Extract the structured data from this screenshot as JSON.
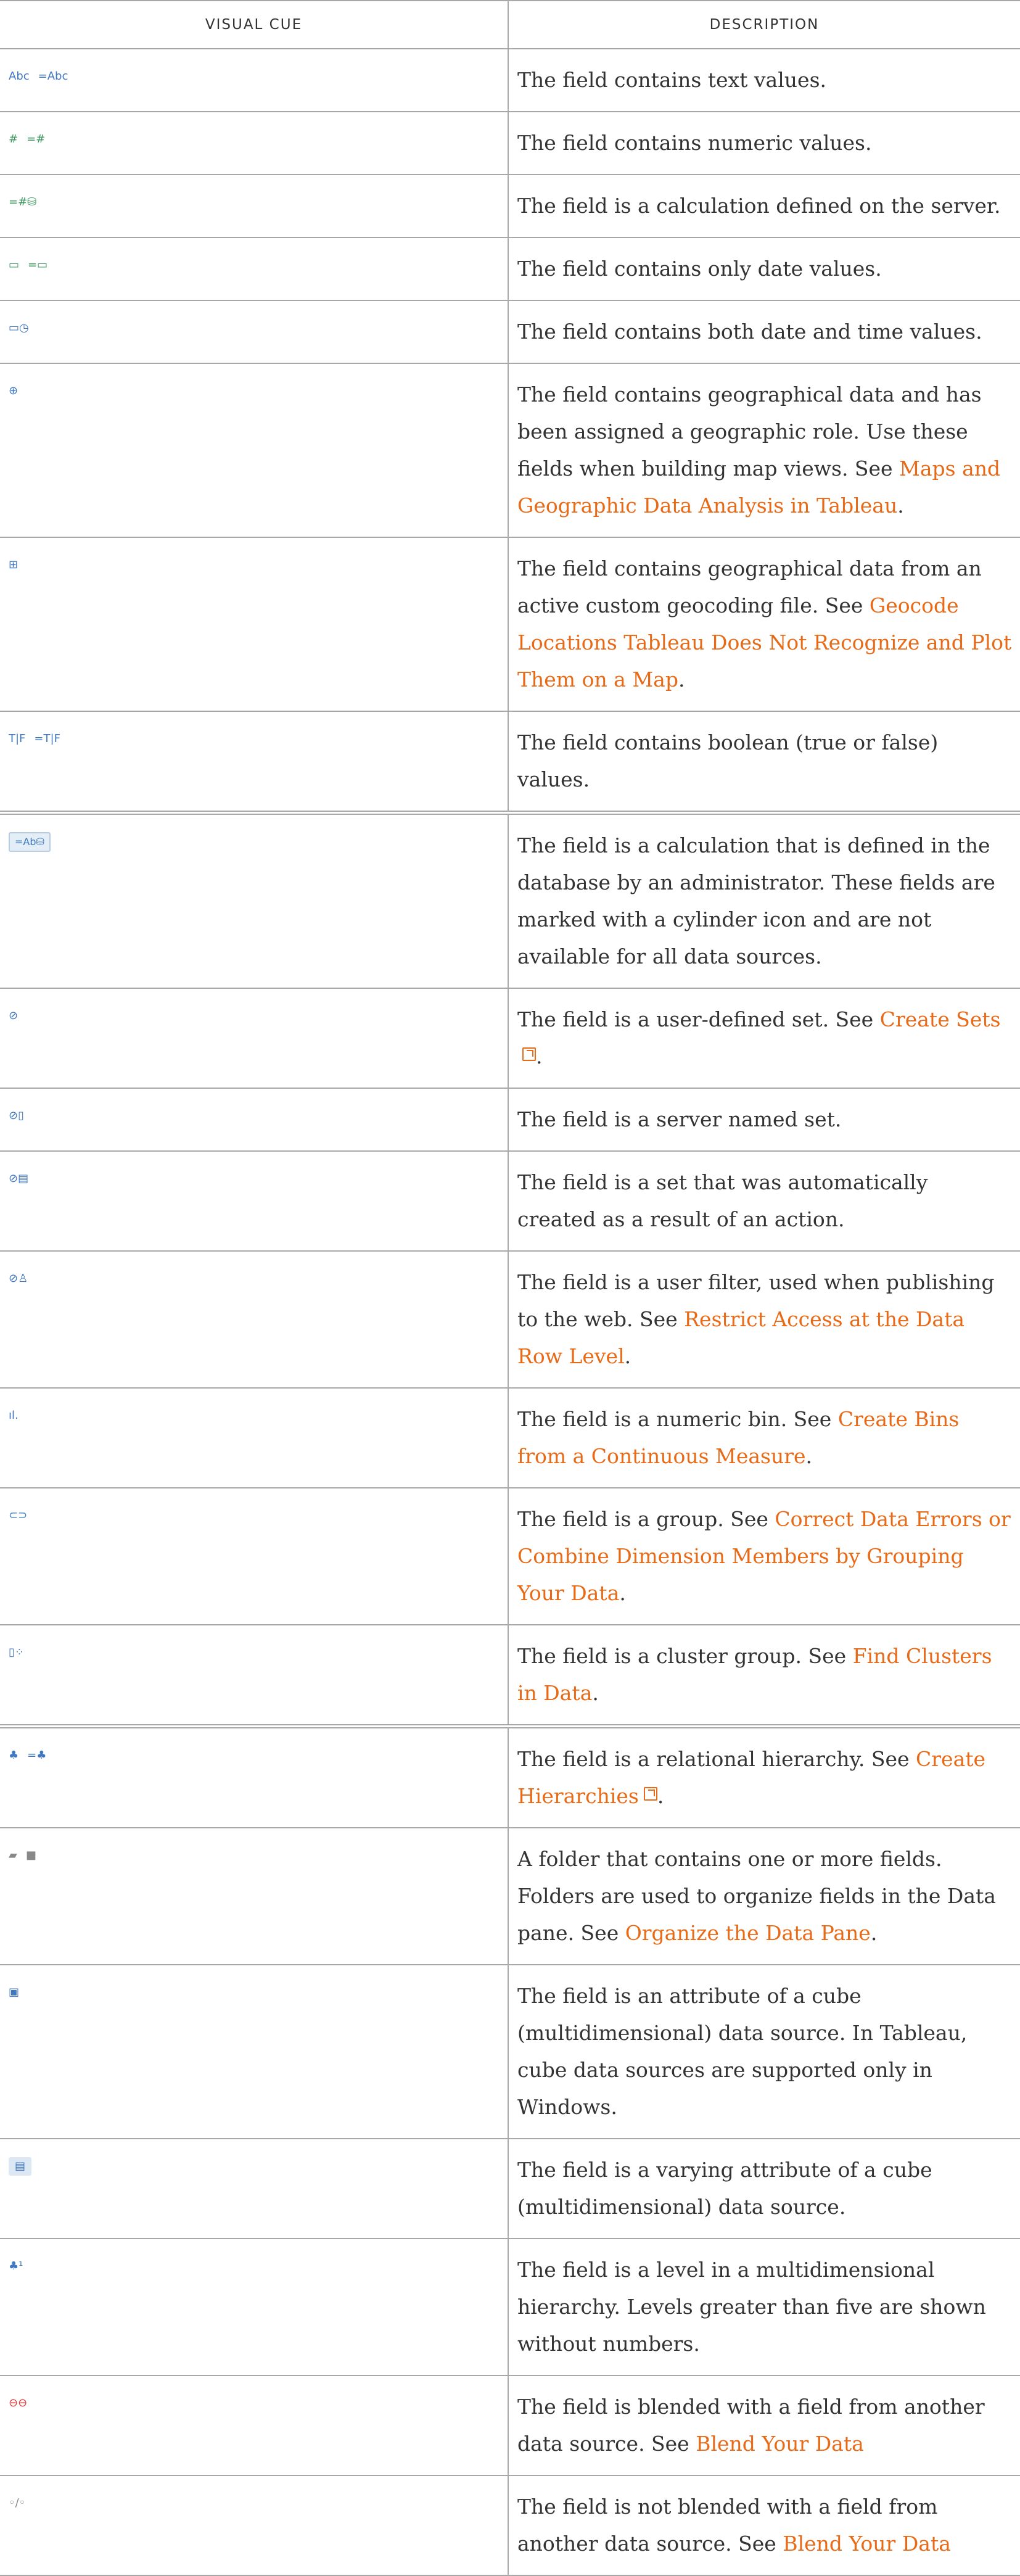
{
  "header": {
    "col1": "VISUAL CUE",
    "col2": "DESCRIPTION"
  },
  "rows": [
    {
      "icons": [
        {
          "glyph": "Abc",
          "icon": "text-icon"
        },
        {
          "glyph": "=Abc",
          "icon": "text-calc-icon"
        }
      ],
      "text": [
        "The field contains text values."
      ]
    },
    {
      "icons": [
        {
          "glyph": "#",
          "icon": "number-icon"
        },
        {
          "glyph": "=#",
          "icon": "number-calc-icon"
        }
      ],
      "text": [
        "The field contains numeric values."
      ]
    },
    {
      "icons": [
        {
          "glyph": "=#⛁",
          "icon": "server-calc-icon"
        }
      ],
      "text": [
        "The field is a calculation defined on the server."
      ]
    },
    {
      "icons": [
        {
          "glyph": "▭",
          "icon": "date-icon"
        },
        {
          "glyph": "=▭",
          "icon": "date-calc-icon"
        }
      ],
      "text": [
        "The field contains only date values."
      ]
    },
    {
      "icons": [
        {
          "glyph": "▭◷",
          "icon": "datetime-icon"
        }
      ],
      "text": [
        "The field contains both date and time values."
      ]
    },
    {
      "icons": [
        {
          "glyph": "⊕",
          "icon": "globe-icon"
        }
      ],
      "text": [
        "The field contains geographical data and has been assigned a geographic role. Use these fields when building map views. See "
      ],
      "link": "Maps and Geographic Data Analysis in Tableau",
      "after": "."
    },
    {
      "icons": [
        {
          "glyph": "⊞",
          "icon": "custom-geocode-icon"
        }
      ],
      "text": [
        "The field contains geographical data from an active custom geocoding file. See "
      ],
      "link": "Geocode Locations Tableau Does Not Recognize and Plot Them on a Map",
      "after": "."
    },
    {
      "icons": [
        {
          "glyph": "T|F",
          "icon": "boolean-icon"
        },
        {
          "glyph": "=T|F",
          "icon": "boolean-calc-icon"
        }
      ],
      "text": [
        "The field contains boolean (true or false) values."
      ]
    },
    {
      "icons": [
        {
          "glyph": "=Ab⛁",
          "icon": "database-calc-icon"
        }
      ],
      "text": [
        "The field is a calculation that is defined in the database by an administrator. These fields are marked with a cylinder icon and are not available for all data sources."
      ]
    },
    {
      "icons": [
        {
          "glyph": "⊘",
          "icon": "set-icon"
        }
      ],
      "text": [
        "The field is a user-defined set. See "
      ],
      "link": "Create Sets",
      "after": ".",
      "ext": true
    },
    {
      "icons": [
        {
          "glyph": "⊘▯",
          "icon": "server-set-icon"
        }
      ],
      "text": [
        "The field is a server named set."
      ]
    },
    {
      "icons": [
        {
          "glyph": "⊘▤",
          "icon": "action-set-icon"
        }
      ],
      "text": [
        "The field is a set that was automatically created as a result of an action."
      ]
    },
    {
      "icons": [
        {
          "glyph": "⊘♙",
          "icon": "user-filter-icon"
        }
      ],
      "text": [
        "The field is a user filter, used when publishing to the web. See "
      ],
      "link": "Restrict Access at the Data Row Level",
      "after": "."
    },
    {
      "icons": [
        {
          "glyph": "ıl.",
          "icon": "bin-icon"
        }
      ],
      "text": [
        "The field is a numeric bin. See "
      ],
      "link": "Create Bins from a Continuous Measure",
      "after": "."
    },
    {
      "icons": [
        {
          "glyph": "⊂⊃",
          "icon": "group-icon"
        }
      ],
      "text": [
        "The field is a group. See "
      ],
      "link": "Correct Data Errors or Combine Dimension Members by Grouping Your Data",
      "after": "."
    },
    {
      "icons": [
        {
          "glyph": "▯⁘",
          "icon": "cluster-icon"
        }
      ],
      "text": [
        "The field is a cluster group. See "
      ],
      "link": "Find Clusters in Data",
      "after": "."
    },
    {
      "icons": [
        {
          "glyph": "♣",
          "icon": "hierarchy-icon"
        },
        {
          "glyph": "=♣",
          "icon": "hierarchy-calc-icon"
        }
      ],
      "text": [
        "The field is a relational hierarchy. See "
      ],
      "link": "Create Hierarchies",
      "after": ".",
      "ext": true
    },
    {
      "icons": [
        {
          "glyph": "▰",
          "icon": "folder-open-icon"
        },
        {
          "glyph": "■",
          "icon": "folder-icon"
        }
      ],
      "text": [
        "A folder that contains one or more fields. Folders are used to organize fields in the Data pane. See "
      ],
      "link": "Organize the Data Pane",
      "after": "."
    },
    {
      "icons": [
        {
          "glyph": "▣",
          "icon": "cube-attribute-icon"
        }
      ],
      "text": [
        "The field is an attribute of a cube (multidimensional) data source. In Tableau, cube data sources are supported only in Windows."
      ]
    },
    {
      "icons": [
        {
          "glyph": "▤",
          "icon": "varying-attribute-icon"
        }
      ],
      "text": [
        "The field is a varying attribute of a cube (multidimensional) data source."
      ]
    },
    {
      "icons": [
        {
          "glyph": "♣¹",
          "icon": "level-icon"
        }
      ],
      "text": [
        "The field is a level in a multidimensional hierarchy. Levels greater than five are shown without numbers."
      ]
    },
    {
      "icons": [
        {
          "glyph": "⊖⊖",
          "icon": "link-icon"
        }
      ],
      "text": [
        "The field is blended with a field from another data source. See "
      ],
      "link": "Blend Your Data",
      "after": ""
    },
    {
      "icons": [
        {
          "glyph": "◦/◦",
          "icon": "broken-link-icon"
        }
      ],
      "text": [
        "The field is not blended with a field from another data source. See "
      ],
      "link": "Blend Your Data",
      "after": ""
    }
  ]
}
